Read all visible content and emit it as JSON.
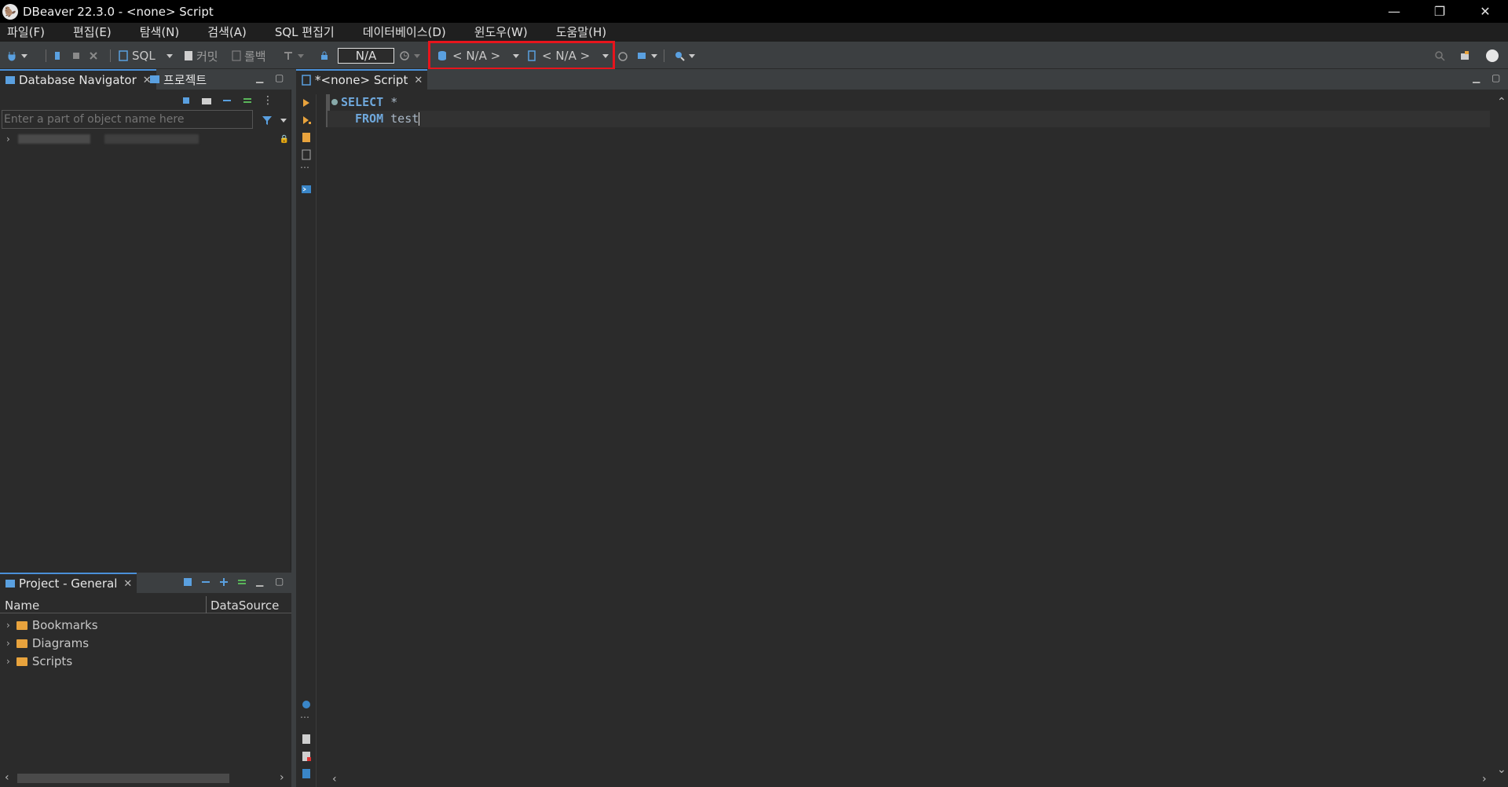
{
  "window": {
    "title": "DBeaver 22.3.0 - <none> Script",
    "controls": {
      "minimize": "—",
      "restore": "❐",
      "close": "✕"
    }
  },
  "menu": [
    "파일(F)",
    "편집(E)",
    "탐색(N)",
    "검색(A)",
    "SQL 편집기",
    "데이터베이스(D)",
    "윈도우(W)",
    "도움말(H)"
  ],
  "toolbar": {
    "sql_label": "SQL",
    "commit_label": "커밋",
    "rollback_label": "롤백",
    "transaction_mode": "N/A",
    "datasource_selector": "< N/A >",
    "schema_selector": "< N/A >"
  },
  "navigator": {
    "tabs": [
      {
        "label": "Database Navigator",
        "close": "✕"
      },
      {
        "label": "프로젝트"
      }
    ],
    "filter_placeholder": "Enter a part of object name here"
  },
  "project_panel": {
    "tab_label": "Project - General",
    "tab_close": "✕",
    "columns": [
      "Name",
      "DataSource"
    ],
    "items": [
      "Bookmarks",
      "Diagrams",
      "Scripts"
    ]
  },
  "editor": {
    "tab_label": "*<none> Script",
    "tab_close": "✕",
    "code": {
      "line1_kw": "SELECT",
      "line1_rest": " *",
      "line2_kw": "FROM",
      "line2_rest": " test"
    }
  },
  "colors": {
    "highlight_box": "#e8141c",
    "keyword": "#6fa8dc",
    "accent": "#4a90d9",
    "folder": "#e8a33d"
  }
}
